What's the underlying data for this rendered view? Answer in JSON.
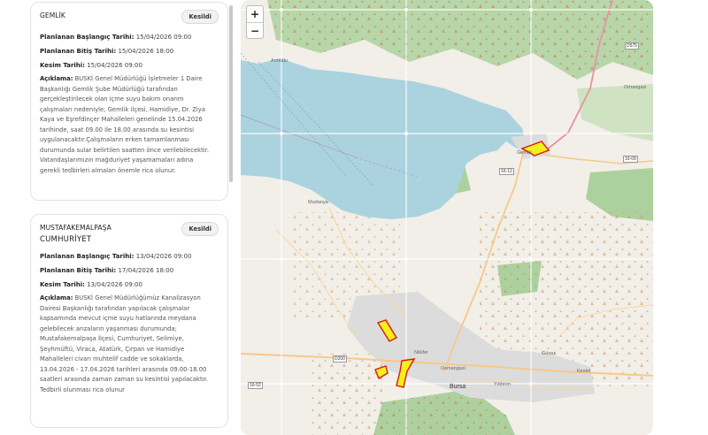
{
  "outages": [
    {
      "district": "GEMLİK",
      "neighborhood": "",
      "status": "Kesildi",
      "start_label": "Planlanan Başlangıç Tarihi:",
      "start_value": "15/04/2026 09:00",
      "end_label": "Planlanan Bitiş Tarihi:",
      "end_value": "15/04/2026 18:00",
      "cut_label": "Kesim Tarihi:",
      "cut_value": "15/04/2026 09:00",
      "desc_label": "Açıklama:",
      "desc_lines": [
        "BUSKİ Genel Müdürlüğü İşletmeler 1 Daire",
        "Başkanlığı Gemlik Şube Müdürlüğü tarafından",
        "gerçekleştirilecek olan içme suyu bakım onarım",
        "çalışmaları nedeniyle; Gemlik ilçesi, Hamidiye, Dr. Ziya",
        "Kaya ve Eşrefdinçer Mahalleleri genelinde 15.04.2026",
        "tarihinde, saat 09.00 ile 18.00 arasında su kesintisi",
        "uygulanacaktır.Çalışmaların erken tamamlanması",
        "durumunda sular belirtilen saatten önce verilebilecektir.",
        "Vatandaşlarımızın mağduriyet yaşamamaları adına",
        "gerekli tedbirleri almaları önemle rica olunur."
      ]
    },
    {
      "district": "MUSTAFAKEMALPAŞA",
      "neighborhood": "CUMHURİYET",
      "status": "Kesildi",
      "start_label": "Planlanan Başlangıç Tarihi:",
      "start_value": "13/04/2026 09:00",
      "end_label": "Planlanan Bitiş Tarihi:",
      "end_value": "17/04/2026 18:00",
      "cut_label": "Kesim Tarihi:",
      "cut_value": "13/04/2026 09:00",
      "desc_label": "Açıklama:",
      "desc_lines": [
        "BUSKİ Genel Müdürlüğümüz Kanalizasyon",
        "Dairesi Başkanlığı tarafından yapılacak çalışmalar",
        "kapsamında mevcut içme suyu hatlarında meydana",
        "gelebilecek arızaların yaşanması durumunda;",
        "Mustafakemalpaşa İlçesi, Cumhuriyet, Selimiye,",
        "Şeyhmüftü, Viraca, Atatürk, Çırpan ve Hamidiye",
        "Mahalleleri civarı muhtelif cadde ve sokaklarda,",
        "13.04.2026 - 17.04.2026 tarihleri arasında 09.00-18.00",
        "saatleri arasında zaman zaman su kesintisi yapılacaktır.",
        "Tedbirli olunması rica olunur"
      ]
    }
  ],
  "map": {
    "zoom_in": "+",
    "zoom_out": "−",
    "labels": {
      "armutlu": "Armutlu",
      "gemlik": "Gemlik",
      "mudanya": "Mudanya",
      "orhangazi": "Orhangazi",
      "osmangazi": "Osmangazi",
      "bursa": "Bursa",
      "nilufer": "Nilüfer",
      "yildirim": "Yıldırım",
      "kestel": "Kestel",
      "gursu": "Gürsu"
    },
    "roads": {
      "d575": "D575",
      "r1612": "16-12",
      "r1609": "16-09",
      "d200": "D200",
      "r1652": "16-52"
    },
    "colors": {
      "sea": "#aad3df",
      "forest": "#add19e",
      "land": "#f2efe9",
      "urban": "#dcdcdc",
      "outage_fill": "#f5ef1a",
      "outage_stroke": "#d81818"
    }
  }
}
